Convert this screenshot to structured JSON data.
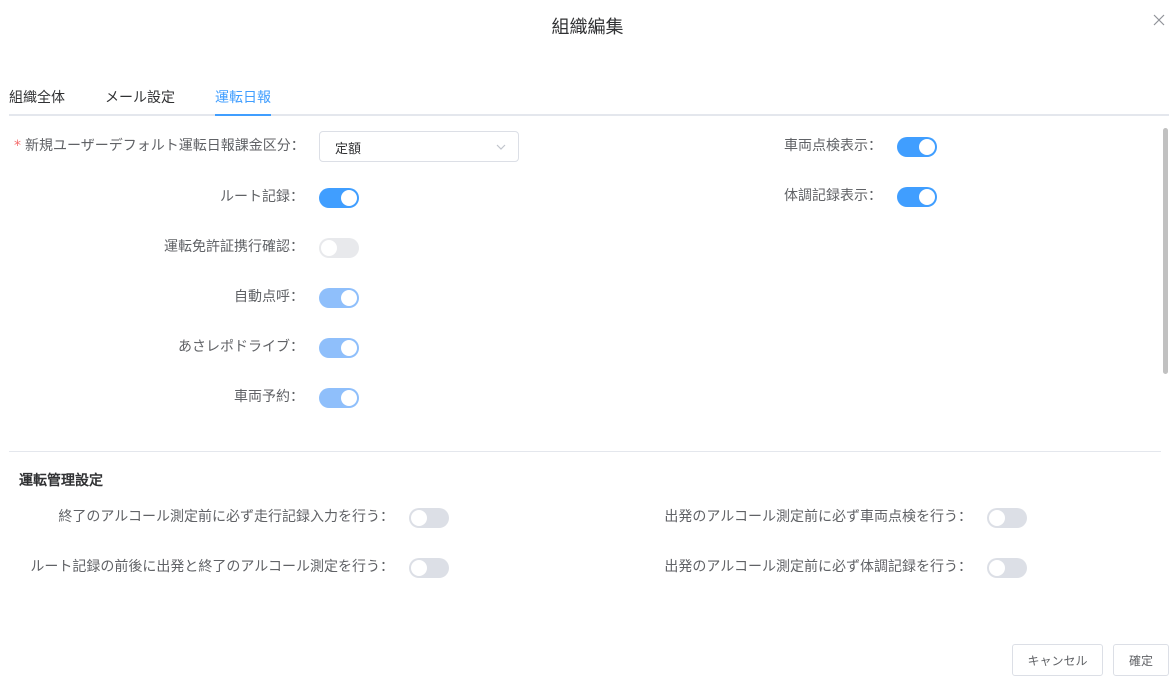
{
  "dialog": {
    "title": "組織編集"
  },
  "tabs": [
    {
      "label": "組織全体"
    },
    {
      "label": "メール設定"
    },
    {
      "label": "運転日報"
    }
  ],
  "active_tab": "運転日報",
  "form": {
    "billing_label": "新規ユーザーデフォルト運転日報課金区分：",
    "billing_value": "定額",
    "route_label": "ルート記録：",
    "license_label": "運転免許証携行確認：",
    "auto_rollcall_label": "自動点呼：",
    "asarepo_label": "あさレポドライブ：",
    "reservation_label": "車両予約：",
    "vehicle_inspection_label": "車両点検表示：",
    "health_label": "体調記録表示："
  },
  "toggles": {
    "route": true,
    "license": false,
    "auto_rollcall": true,
    "asarepo": true,
    "reservation": true,
    "vehicle_inspection": true,
    "health": true
  },
  "management": {
    "title": "運転管理設定",
    "end_label": "終了のアルコール測定前に必ず走行記録入力を行う：",
    "route_measure_label": "ルート記録の前後に出発と終了のアルコール測定を行う：",
    "start_inspection_label": "出発のアルコール測定前に必ず車両点検を行う：",
    "start_health_label": "出発のアルコール測定前に必ず体調記録を行う："
  },
  "buttons": {
    "cancel": "キャンセル",
    "confirm": "確定"
  },
  "colors": {
    "accent": "#409eff",
    "required": "#f56c6c",
    "switch_off": "#dcdfe6"
  }
}
